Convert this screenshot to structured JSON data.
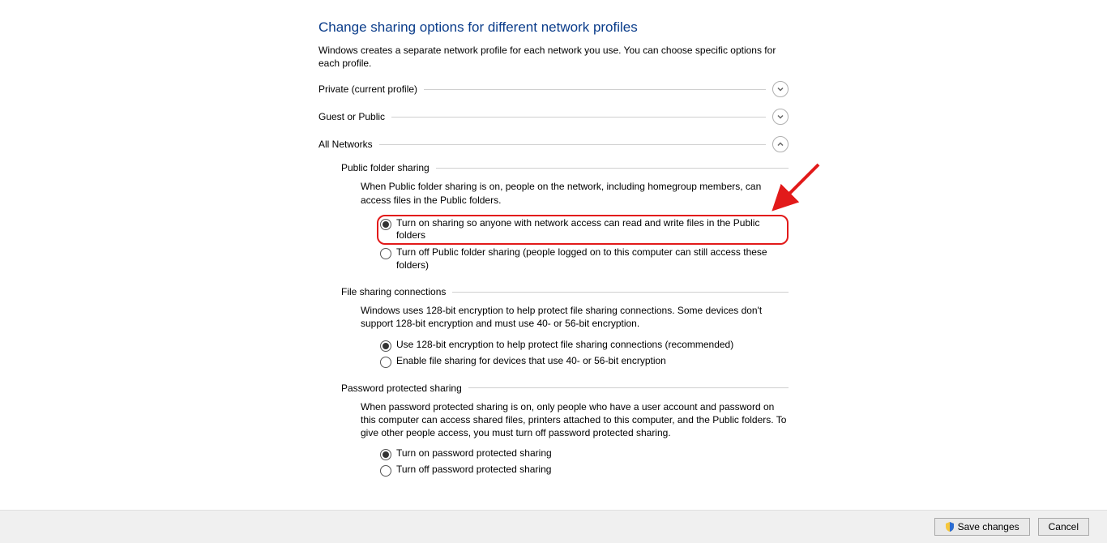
{
  "title": "Change sharing options for different network profiles",
  "subtitle": "Windows creates a separate network profile for each network you use. You can choose specific options for each profile.",
  "sections": {
    "private": {
      "label": "Private (current profile)",
      "expanded": false
    },
    "guest": {
      "label": "Guest or Public",
      "expanded": false
    },
    "all": {
      "label": "All Networks",
      "expanded": true
    }
  },
  "all_networks": {
    "public_folder": {
      "title": "Public folder sharing",
      "desc": "When Public folder sharing is on, people on the network, including homegroup members, can access files in the Public folders.",
      "opt_on": "Turn on sharing so anyone with network access can read and write files in the Public folders",
      "opt_off": "Turn off Public folder sharing (people logged on to this computer can still access these folders)",
      "selected": "on"
    },
    "file_sharing": {
      "title": "File sharing connections",
      "desc": "Windows uses 128-bit encryption to help protect file sharing connections. Some devices don't support 128-bit encryption and must use 40- or 56-bit encryption.",
      "opt_128": "Use 128-bit encryption to help protect file sharing connections (recommended)",
      "opt_40": "Enable file sharing for devices that use 40- or 56-bit encryption",
      "selected": "128"
    },
    "password": {
      "title": "Password protected sharing",
      "desc": "When password protected sharing is on, only people who have a user account and password on this computer can access shared files, printers attached to this computer, and the Public folders. To give other people access, you must turn off password protected sharing.",
      "opt_on": "Turn on password protected sharing",
      "opt_off": "Turn off password protected sharing",
      "selected": "on"
    }
  },
  "footer": {
    "save": "Save changes",
    "cancel": "Cancel"
  }
}
